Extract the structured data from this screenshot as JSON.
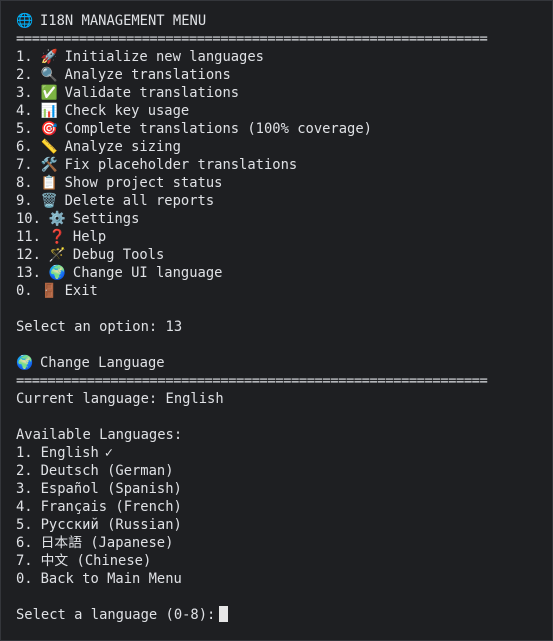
{
  "menu": {
    "title_icon": "🌐",
    "title": "I18N MANAGEMENT MENU",
    "separator": "============================================================",
    "items": [
      {
        "num": "1.",
        "icon": "🚀",
        "label": "Initialize new languages"
      },
      {
        "num": "2.",
        "icon": "🔍",
        "label": "Analyze translations"
      },
      {
        "num": "3.",
        "icon": "✅",
        "label": "Validate translations"
      },
      {
        "num": "4.",
        "icon": "📊",
        "label": "Check key usage"
      },
      {
        "num": "5.",
        "icon": "🎯",
        "label": "Complete translations (100% coverage)"
      },
      {
        "num": "6.",
        "icon": "📏",
        "label": "Analyze sizing"
      },
      {
        "num": "7.",
        "icon": "🛠️",
        "label": "Fix placeholder translations"
      },
      {
        "num": "8.",
        "icon": "📋",
        "label": "Show project status"
      },
      {
        "num": "9.",
        "icon": "🗑️",
        "label": "Delete all reports"
      },
      {
        "num": "10.",
        "icon": "⚙️",
        "label": "Settings"
      },
      {
        "num": "11.",
        "icon": "❓",
        "label": "Help"
      },
      {
        "num": "12.",
        "icon": "🪄",
        "label": "Debug Tools"
      },
      {
        "num": "13.",
        "icon": "🌍",
        "label": "Change UI language"
      },
      {
        "num": "0.",
        "icon": "🚪",
        "label": "Exit"
      }
    ],
    "prompt": "Select an option: 13"
  },
  "language": {
    "title_icon": "🌍",
    "title": "Change Language",
    "separator": "============================================================",
    "current": "Current language: English",
    "available_header": "Available Languages:",
    "options": [
      {
        "num": "1.",
        "label": "English",
        "check": "✓"
      },
      {
        "num": "2.",
        "label": "Deutsch (German)",
        "check": ""
      },
      {
        "num": "3.",
        "label": "Español (Spanish)",
        "check": ""
      },
      {
        "num": "4.",
        "label": "Français (French)",
        "check": ""
      },
      {
        "num": "5.",
        "label": "Русский (Russian)",
        "check": ""
      },
      {
        "num": "6.",
        "label": "日本語 (Japanese)",
        "check": ""
      },
      {
        "num": "7.",
        "label": "中文 (Chinese)",
        "check": ""
      },
      {
        "num": "0.",
        "label": "Back to Main Menu",
        "check": ""
      }
    ],
    "prompt": "Select a language (0-8):"
  }
}
